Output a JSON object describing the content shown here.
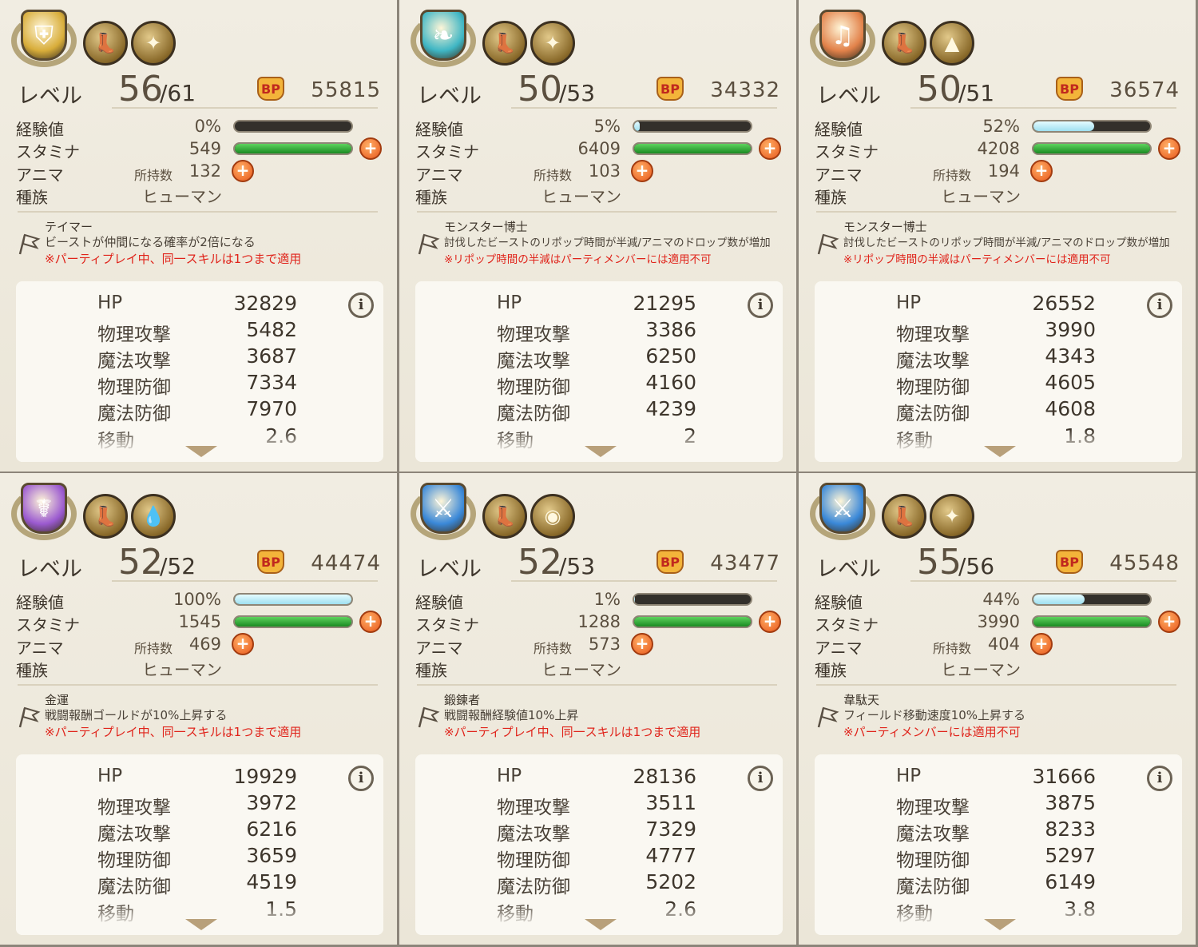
{
  "labels": {
    "level": "レベル",
    "exp": "経験値",
    "stamina": "スタミナ",
    "anima": "アニマ",
    "owned": "所持数",
    "race": "種族",
    "bp": "BP",
    "plus": "+",
    "info": "i",
    "stat_names": [
      "HP",
      "物理攻撃",
      "魔法攻撃",
      "物理防御",
      "魔法防御",
      "移動"
    ]
  },
  "colors": {
    "skill_note": "#e0231a",
    "stamina_bar": "#1a8a22",
    "exp_bar": "#9fe0f0",
    "plus_button": "#e8561a"
  },
  "cards": [
    {
      "job_icon": "shield-crest-icon",
      "job_color": "#d8ad3a",
      "gear_icons": [
        "boot-icon",
        "compass-medal-icon"
      ],
      "level": "56",
      "level_max": "/61",
      "bp": "55815",
      "exp": "0%",
      "exp_fill": 0,
      "stamina": "549",
      "stamina_fill": 1,
      "anima_owned": "132",
      "race": "ヒューマン",
      "skill_name": "テイマー",
      "skill_desc": "ビーストが仲間になる確率が2倍になる",
      "skill_note": "※パーティプレイ中、同一スキルは1つまで適用",
      "stats": [
        "32829",
        "5482",
        "3687",
        "7334",
        "7970",
        "2.6"
      ]
    },
    {
      "job_icon": "wings-crest-icon",
      "job_color": "#3fb6c4",
      "gear_icons": [
        "boot-icon",
        "compass-medal-icon"
      ],
      "level": "50",
      "level_max": "/53",
      "bp": "34332",
      "exp": "5%",
      "exp_fill": 0.05,
      "stamina": "6409",
      "stamina_fill": 1,
      "anima_owned": "103",
      "race": "ヒューマン",
      "skill_name": "モンスター博士",
      "skill_desc": "討伐したビーストのリポップ時間が半減/アニマのドロップ数が増加",
      "skill_note": "※リポップ時間の半減はパーティメンバーには適用不可",
      "stats": [
        "21295",
        "3386",
        "6250",
        "4160",
        "4239",
        "2"
      ]
    },
    {
      "job_icon": "lyre-crest-icon",
      "job_color": "#e2824a",
      "gear_icons": [
        "boot-icon",
        "gold-helm-icon"
      ],
      "level": "50",
      "level_max": "/51",
      "bp": "36574",
      "exp": "52%",
      "exp_fill": 0.52,
      "stamina": "4208",
      "stamina_fill": 1,
      "anima_owned": "194",
      "race": "ヒューマン",
      "skill_name": "モンスター博士",
      "skill_desc": "討伐したビーストのリポップ時間が半減/アニマのドロップ数が増加",
      "skill_note": "※リポップ時間の半減はパーティメンバーには適用不可",
      "stats": [
        "26552",
        "3990",
        "4343",
        "4605",
        "4608",
        "1.8"
      ]
    },
    {
      "job_icon": "staff-crest-icon",
      "job_color": "#9b5ad0",
      "gear_icons": [
        "boot-icon",
        "water-drop-icon"
      ],
      "level": "52",
      "level_max": "/52",
      "bp": "44474",
      "exp": "100%",
      "exp_fill": 1,
      "stamina": "1545",
      "stamina_fill": 1,
      "anima_owned": "469",
      "race": "ヒューマン",
      "skill_name": "金運",
      "skill_desc": "戦闘報酬ゴールドが10%上昇する",
      "skill_note": "※パーティプレイ中、同一スキルは1つまで適用",
      "stats": [
        "19929",
        "3972",
        "6216",
        "3659",
        "4519",
        "1.5"
      ]
    },
    {
      "job_icon": "sword-crest-icon",
      "job_color": "#3a88d8",
      "gear_icons": [
        "boot-icon",
        "evil-eye-icon"
      ],
      "level": "52",
      "level_max": "/53",
      "bp": "43477",
      "exp": "1%",
      "exp_fill": 0.01,
      "stamina": "1288",
      "stamina_fill": 1,
      "anima_owned": "573",
      "race": "ヒューマン",
      "skill_name": "鍛錬者",
      "skill_desc": "戦闘報酬経験値10%上昇",
      "skill_note": "※パーティプレイ中、同一スキルは1つまで適用",
      "stats": [
        "28136",
        "3511",
        "7329",
        "4777",
        "5202",
        "2.6"
      ]
    },
    {
      "job_icon": "sword-crest-icon",
      "job_color": "#3a88d8",
      "gear_icons": [
        "boot-icon",
        "compass-medal-icon"
      ],
      "level": "55",
      "level_max": "/56",
      "bp": "45548",
      "exp": "44%",
      "exp_fill": 0.44,
      "stamina": "3990",
      "stamina_fill": 1,
      "anima_owned": "404",
      "race": "ヒューマン",
      "skill_name": "韋駄天",
      "skill_desc": "フィールド移動速度10%上昇する",
      "skill_note": "※パーティメンバーには適用不可",
      "stats": [
        "31666",
        "3875",
        "8233",
        "5297",
        "6149",
        "3.8"
      ]
    }
  ]
}
